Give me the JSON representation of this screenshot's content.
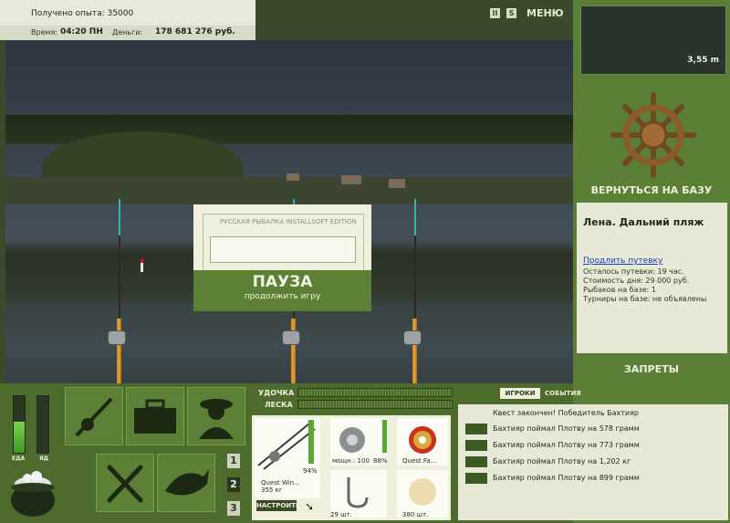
{
  "hud": {
    "experience_label": "Получено опыта: 35000",
    "time_label": "Время:",
    "time_value": "04:20 ПН",
    "money_label": "Деньги:",
    "money_value": "178 681 276 руб."
  },
  "top_buttons": {
    "pause": "II",
    "sound": "S",
    "menu": "МЕНЮ"
  },
  "pause_dialog": {
    "legend": "РУССКАЯ РЫБАЛКА INSTALLSOFT EDITION",
    "title": "ПАУЗА",
    "subtitle": "продолжить игру"
  },
  "depth": "3,55 m",
  "right_panel": {
    "return_label": "ВЕРНУТЬСЯ НА БАЗУ",
    "location_name": "Лена. Дальний пляж",
    "extend_link": "Продлить путевку",
    "lines": [
      "Осталось путевки: 19 час.",
      "Стоимость дня: 29 000 руб.",
      "Рыбаков на базе: 1",
      "Турниры на базе: не объявлены"
    ],
    "bans_label": "ЗАПРЕТЫ"
  },
  "bars": {
    "food_label": "ЕДА",
    "poison_label": "ЯД",
    "food_level": 0.55,
    "poison_level": 0
  },
  "indicators": {
    "rod_label": "УДОЧКА",
    "line_label": "ЛЕСКА"
  },
  "slots": [
    "1",
    "2",
    "3"
  ],
  "gear": {
    "rod_name": "Quest Win...",
    "rod_weight": "355 кг",
    "rod_percent": "94%",
    "reel_power": "мощн.: 100",
    "reel_percent": "88%",
    "line_name": "Quest Fa...",
    "hook_weight": "29 шт.",
    "bait_weight": "380 шт.",
    "setup_button": "НАСТРОИТЬ"
  },
  "events": {
    "tab_players": "ИГРОКИ",
    "tab_events": "СОБЫТИЯ",
    "items": [
      "Квест закончен! Победитель Бахтияр",
      "Бахтияр поймал Плотву на 578 грамм",
      "Бахтияр поймал Плотву на 773 грамм",
      "Бахтияр поймал Плотву на 1,202 кг",
      "Бахтияр поймал Плотву на 899 грамм"
    ]
  }
}
